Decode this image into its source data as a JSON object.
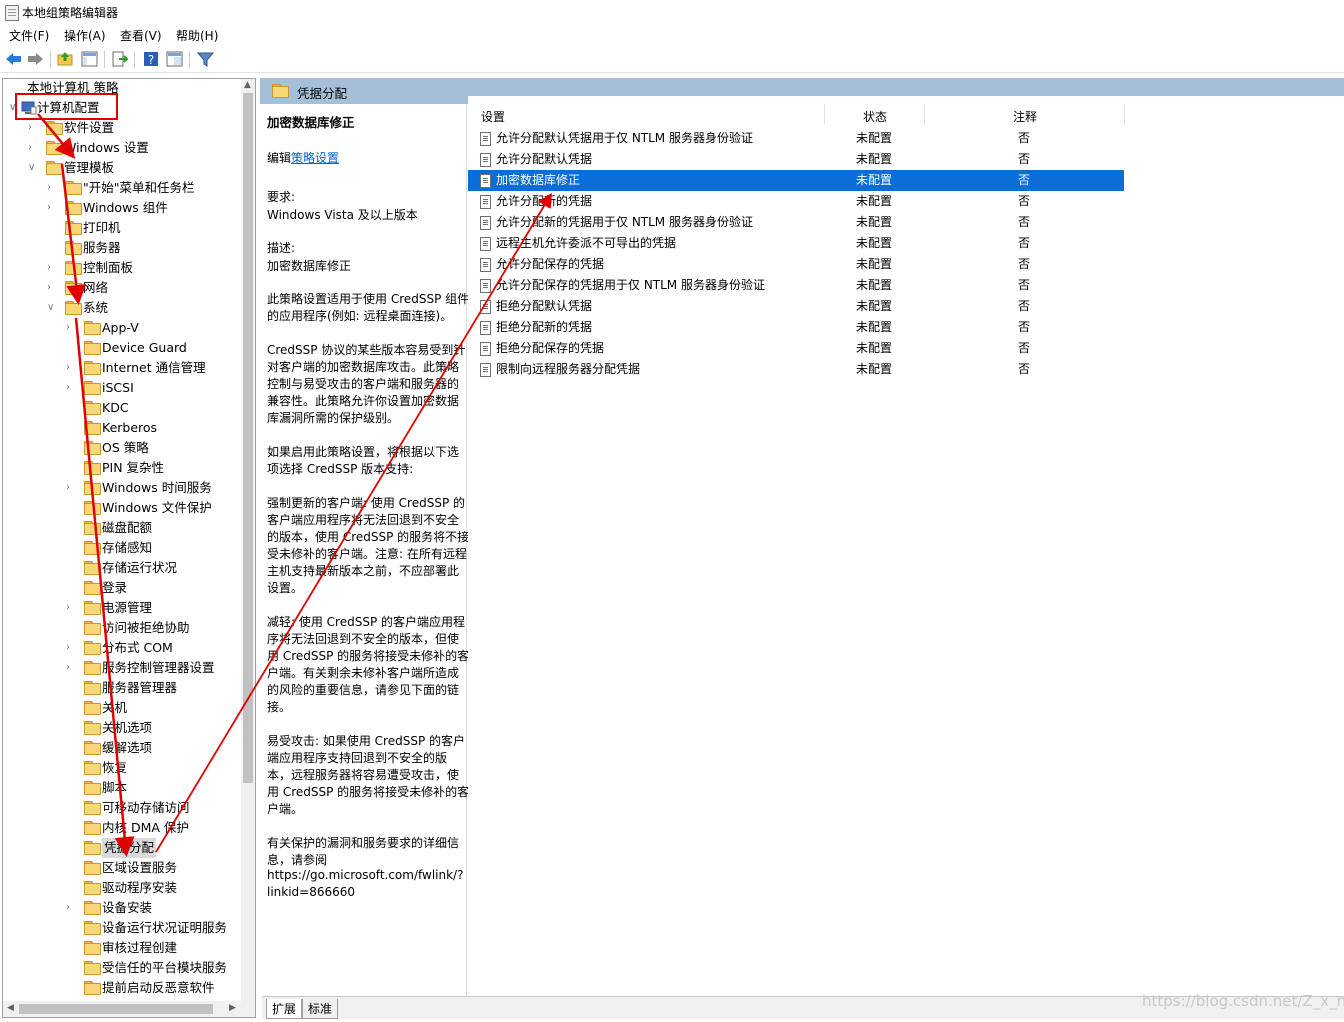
{
  "window": {
    "title": "本地组策略编辑器"
  },
  "menu": [
    "文件(F)",
    "操作(A)",
    "查看(V)",
    "帮助(H)"
  ],
  "toolbar_icons": [
    "back-arrow-icon",
    "forward-arrow-icon",
    "up-folder-icon",
    "show-hide-tree-icon",
    "export-list-icon",
    "help-icon",
    "properties-icon",
    "filter-icon"
  ],
  "tree": {
    "root": "本地计算机 策略",
    "computer_config": "计算机配置",
    "software": "软件设置",
    "windows_settings": "Windows 设置",
    "admin_templates": "管理模板",
    "admin_children": [
      "\"开始\"菜单和任务栏",
      "Windows 组件",
      "打印机",
      "服务器",
      "控制面板",
      "网络",
      "系统"
    ],
    "system_children": [
      "App-V",
      "Device Guard",
      "Internet 通信管理",
      "iSCSI",
      "KDC",
      "Kerberos",
      "OS 策略",
      "PIN 复杂性",
      "Windows 时间服务",
      "Windows 文件保护",
      "磁盘配额",
      "存储感知",
      "存储运行状况",
      "登录",
      "电源管理",
      "访问被拒绝协助",
      "分布式 COM",
      "服务控制管理器设置",
      "服务器管理器",
      "关机",
      "关机选项",
      "缓解选项",
      "恢复",
      "脚本",
      "可移动存储访问",
      "内核 DMA 保护",
      "凭据分配",
      "区域设置服务",
      "驱动程序安装",
      "设备安装",
      "设备运行状况证明服务",
      "审核过程创建",
      "受信任的平台模块服务",
      "提前启动反恶意软件"
    ]
  },
  "detail": {
    "header": "凭据分配",
    "policy_title": "加密数据库修正",
    "edit_prefix": "编辑",
    "edit_link": "策略设置",
    "lines": [
      "要求:",
      "Windows Vista 及以上版本",
      "描述:",
      "加密数据库修正",
      "此策略设置适用于使用 CredSSP 组件",
      "的应用程序(例如: 远程桌面连接)。",
      "CredSSP 协议的某些版本容易受到针",
      "对客户端的加密数据库攻击。此策略",
      "控制与易受攻击的客户端和服务器的",
      "兼容性。此策略允许你设置加密数据",
      "库漏洞所需的保护级别。",
      "如果启用此策略设置，将根据以下选",
      "项选择 CredSSP 版本支持:",
      "强制更新的客户端: 使用 CredSSP 的",
      "客户端应用程序将无法回退到不安全",
      "的版本，使用 CredSSP 的服务将不接",
      "受未修补的客户端。注意: 在所有远程",
      "主机支持最新版本之前，不应部署此",
      "设置。",
      "减轻: 使用 CredSSP 的客户端应用程",
      "序将无法回退到不安全的版本，但使",
      "用 CredSSP 的服务将接受未修补的客",
      "户端。有关剩余未修补客户端所造成",
      "的风险的重要信息，请参见下面的链",
      "接。",
      "易受攻击: 如果使用 CredSSP 的客户",
      "端应用程序支持回退到不安全的版",
      "本，远程服务器将容易遭受攻击，使",
      "用 CredSSP 的服务将接受未修补的客",
      "户端。",
      "有关保护的漏洞和服务要求的详细信",
      "息，请参阅",
      "https://go.microsoft.com/fwlink/?",
      "linkid=866660"
    ]
  },
  "list": {
    "columns": [
      "设置",
      "状态",
      "注释"
    ],
    "rows": [
      {
        "name": "允许分配默认凭据用于仅 NTLM 服务器身份验证",
        "state": "未配置",
        "note": "否"
      },
      {
        "name": "允许分配默认凭据",
        "state": "未配置",
        "note": "否"
      },
      {
        "name": "加密数据库修正",
        "state": "未配置",
        "note": "否"
      },
      {
        "name": "允许分配新的凭据",
        "state": "未配置",
        "note": "否"
      },
      {
        "name": "允许分配新的凭据用于仅 NTLM 服务器身份验证",
        "state": "未配置",
        "note": "否"
      },
      {
        "name": "远程主机允许委派不可导出的凭据",
        "state": "未配置",
        "note": "否"
      },
      {
        "name": "允许分配保存的凭据",
        "state": "未配置",
        "note": "否"
      },
      {
        "name": "允许分配保存的凭据用于仅 NTLM 服务器身份验证",
        "state": "未配置",
        "note": "否"
      },
      {
        "name": "拒绝分配默认凭据",
        "state": "未配置",
        "note": "否"
      },
      {
        "name": "拒绝分配新的凭据",
        "state": "未配置",
        "note": "否"
      },
      {
        "name": "拒绝分配保存的凭据",
        "state": "未配置",
        "note": "否"
      },
      {
        "name": "限制向远程服务器分配凭据",
        "state": "未配置",
        "note": "否"
      }
    ],
    "selected_index": 2
  },
  "tabs": [
    "扩展",
    "标准"
  ],
  "watermark": "https://blog.csdn.net/Z_x_n",
  "colors": {
    "selection": "#0a6ed8",
    "header": "#a6bfd8",
    "annotation": "#e00000",
    "link": "#0066cc"
  }
}
